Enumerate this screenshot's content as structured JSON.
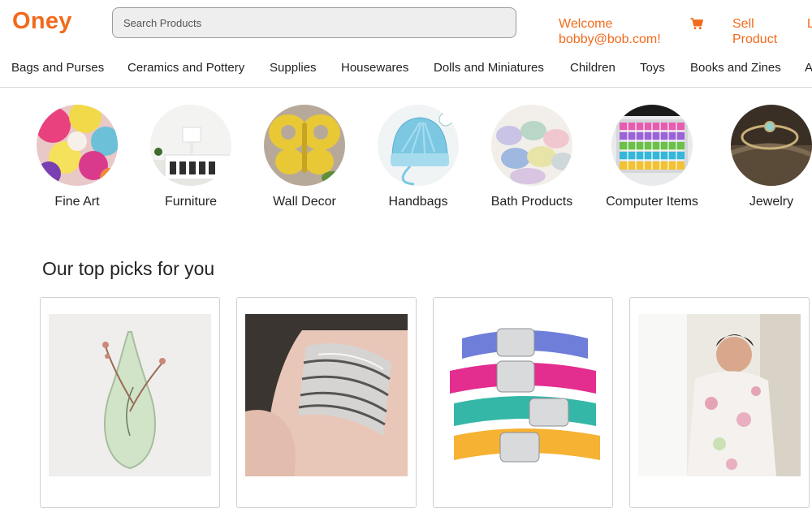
{
  "header": {
    "logo": "Oney",
    "search_placeholder": "Search Products",
    "welcome_line1": "Welcome",
    "welcome_line2": "bobby@bob.com!",
    "cart_icon": "shopping-cart-icon",
    "sell_line1": "Sell",
    "sell_line2": "Product",
    "logout_partial": "L"
  },
  "nav": {
    "items": [
      "Bags and Purses",
      "Ceramics and Pottery",
      "Supplies",
      "Housewares",
      "Dolls and Miniatures",
      "Children",
      "Toys",
      "Books and Zines",
      "A"
    ]
  },
  "categories": [
    {
      "label": "Fine Art"
    },
    {
      "label": "Furniture"
    },
    {
      "label": "Wall Decor"
    },
    {
      "label": "Handbags"
    },
    {
      "label": "Bath Products"
    },
    {
      "label": "Computer Items"
    },
    {
      "label": "Jewelry"
    }
  ],
  "section": {
    "title": "Our top picks for you"
  },
  "colors": {
    "brand": "#f26a1b",
    "text": "#222222",
    "search_bg": "#eeeeee"
  }
}
